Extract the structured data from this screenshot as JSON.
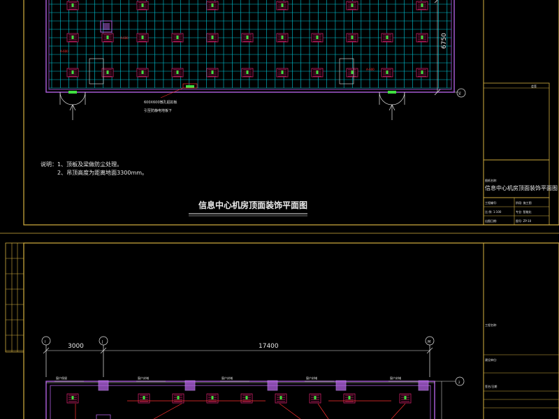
{
  "colors": {
    "background": "#000000",
    "frame": "#d4b040",
    "grid": "#00c8d8",
    "wall": "#b060e0",
    "light": "#d0206a",
    "label": "#e8e8e8",
    "annotation": "#ff3030",
    "dim": "#ffffff"
  },
  "sheet1": {
    "title": "信息中心机房顶面装饰平面图",
    "notes_line1": "说明：1、顶板及梁做防尘处理。",
    "notes_line2": "2、吊顶高度为距离地面3300mm。",
    "dim_vertical": "6750",
    "axis_bubble": "④",
    "callout_line1": "600X600微孔铝扣板",
    "callout_line2": "引至防静电地板下",
    "title_block": {
      "header": "会签",
      "rows": [
        "审 定",
        "审 核",
        "项目负责",
        "校 对",
        "设 计",
        "制 图"
      ],
      "project_label": "图纸名称:",
      "drawing_name": "信息中心机房顶面装饰平面图",
      "info_left_1": "工程编号:",
      "info_right_1": "阶段: 施工图",
      "info_left_2": "比 例: 1:100",
      "info_right_2": "专业: 智能化",
      "info_left_3": "出图日期:",
      "info_right_3": "图号: ZP-10"
    }
  },
  "sheet2": {
    "dim_1": "3000",
    "dim_2": "17400",
    "axis_left": "I",
    "axis_mid": "J",
    "axis_right": "M",
    "axis_side": "2",
    "window_labels": [
      "窗户保留",
      "窗户封堵",
      "窗户封堵",
      "窗户封堵",
      "窗户封堵"
    ],
    "title_block": {
      "project_label": "工程名称:",
      "unit_label": "建设单位:",
      "sign_label": "签名/日期"
    }
  }
}
